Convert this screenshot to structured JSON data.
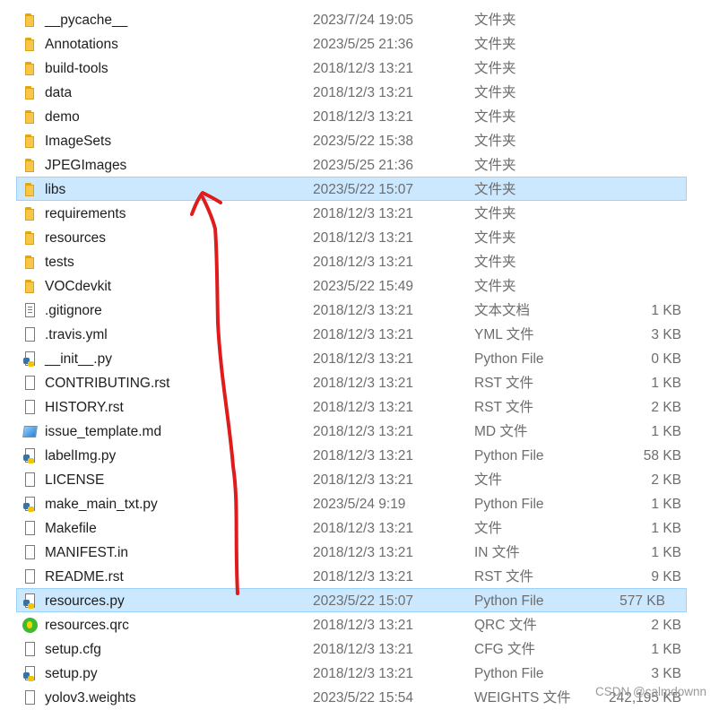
{
  "files": [
    {
      "name": "__pycache__",
      "date": "2023/7/24 19:05",
      "type": "文件夹",
      "size": "",
      "icon": "folder-icon"
    },
    {
      "name": "Annotations",
      "date": "2023/5/25 21:36",
      "type": "文件夹",
      "size": "",
      "icon": "folder-icon"
    },
    {
      "name": "build-tools",
      "date": "2018/12/3 13:21",
      "type": "文件夹",
      "size": "",
      "icon": "folder-icon"
    },
    {
      "name": "data",
      "date": "2018/12/3 13:21",
      "type": "文件夹",
      "size": "",
      "icon": "folder-icon"
    },
    {
      "name": "demo",
      "date": "2018/12/3 13:21",
      "type": "文件夹",
      "size": "",
      "icon": "folder-icon"
    },
    {
      "name": "ImageSets",
      "date": "2023/5/22 15:38",
      "type": "文件夹",
      "size": "",
      "icon": "folder-icon"
    },
    {
      "name": "JPEGImages",
      "date": "2023/5/25 21:36",
      "type": "文件夹",
      "size": "",
      "icon": "folder-icon"
    },
    {
      "name": "libs",
      "date": "2023/5/22 15:07",
      "type": "文件夹",
      "size": "",
      "icon": "folder-icon",
      "selected": true
    },
    {
      "name": "requirements",
      "date": "2018/12/3 13:21",
      "type": "文件夹",
      "size": "",
      "icon": "folder-icon"
    },
    {
      "name": "resources",
      "date": "2018/12/3 13:21",
      "type": "文件夹",
      "size": "",
      "icon": "folder-icon"
    },
    {
      "name": "tests",
      "date": "2018/12/3 13:21",
      "type": "文件夹",
      "size": "",
      "icon": "folder-icon"
    },
    {
      "name": "VOCdevkit",
      "date": "2023/5/22 15:49",
      "type": "文件夹",
      "size": "",
      "icon": "folder-icon"
    },
    {
      "name": ".gitignore",
      "date": "2018/12/3 13:21",
      "type": "文本文档",
      "size": "1 KB",
      "icon": "text-file-icon"
    },
    {
      "name": ".travis.yml",
      "date": "2018/12/3 13:21",
      "type": "YML 文件",
      "size": "3 KB",
      "icon": "file-icon"
    },
    {
      "name": "__init__.py",
      "date": "2018/12/3 13:21",
      "type": "Python File",
      "size": "0 KB",
      "icon": "python-file-icon"
    },
    {
      "name": "CONTRIBUTING.rst",
      "date": "2018/12/3 13:21",
      "type": "RST 文件",
      "size": "1 KB",
      "icon": "file-icon"
    },
    {
      "name": "HISTORY.rst",
      "date": "2018/12/3 13:21",
      "type": "RST 文件",
      "size": "2 KB",
      "icon": "file-icon"
    },
    {
      "name": "issue_template.md",
      "date": "2018/12/3 13:21",
      "type": "MD 文件",
      "size": "1 KB",
      "icon": "markdown-file-icon"
    },
    {
      "name": "labelImg.py",
      "date": "2018/12/3 13:21",
      "type": "Python File",
      "size": "58 KB",
      "icon": "python-file-icon"
    },
    {
      "name": "LICENSE",
      "date": "2018/12/3 13:21",
      "type": "文件",
      "size": "2 KB",
      "icon": "file-icon"
    },
    {
      "name": "make_main_txt.py",
      "date": "2023/5/24 9:19",
      "type": "Python File",
      "size": "1 KB",
      "icon": "python-file-icon"
    },
    {
      "name": "Makefile",
      "date": "2018/12/3 13:21",
      "type": "文件",
      "size": "1 KB",
      "icon": "file-icon"
    },
    {
      "name": "MANIFEST.in",
      "date": "2018/12/3 13:21",
      "type": "IN 文件",
      "size": "1 KB",
      "icon": "file-icon"
    },
    {
      "name": "README.rst",
      "date": "2018/12/3 13:21",
      "type": "RST 文件",
      "size": "9 KB",
      "icon": "file-icon"
    },
    {
      "name": "resources.py",
      "date": "2023/5/22 15:07",
      "type": "Python File",
      "size": "577 KB",
      "icon": "python-file-icon",
      "selected": true
    },
    {
      "name": "resources.qrc",
      "date": "2018/12/3 13:21",
      "type": "QRC 文件",
      "size": "2 KB",
      "icon": "qrc-file-icon"
    },
    {
      "name": "setup.cfg",
      "date": "2018/12/3 13:21",
      "type": "CFG 文件",
      "size": "1 KB",
      "icon": "file-icon"
    },
    {
      "name": "setup.py",
      "date": "2018/12/3 13:21",
      "type": "Python File",
      "size": "3 KB",
      "icon": "python-file-icon"
    },
    {
      "name": "yolov3.weights",
      "date": "2023/5/22 15:54",
      "type": "WEIGHTS 文件",
      "size": "242,195 KB",
      "icon": "file-icon"
    }
  ],
  "watermark": "CSDN @calmdownn",
  "colors": {
    "selection_bg": "#cce8ff",
    "selection_border": "#99d1ff",
    "annotation_arrow": "#e01b1b",
    "secondary_text": "#6d6d6d"
  }
}
